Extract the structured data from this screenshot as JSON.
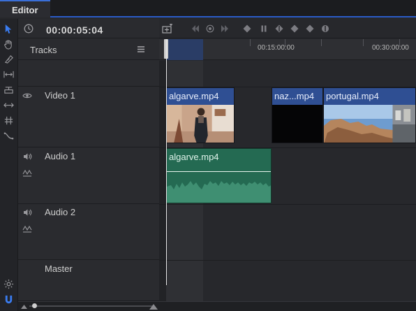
{
  "tab": {
    "label": "Editor"
  },
  "timecode": "00:00:05:04",
  "tracks_header": {
    "label": "Tracks"
  },
  "ruler": {
    "labels": [
      "00:15:00:00",
      "00:30:00:00"
    ]
  },
  "tracks": [
    {
      "name": "Video 1"
    },
    {
      "name": "Audio 1"
    },
    {
      "name": "Audio 2"
    },
    {
      "name": "Master"
    }
  ],
  "video_clips": [
    {
      "title": "algarve.mp4"
    },
    {
      "title": "naz...mp4"
    },
    {
      "title": "portugal.mp4"
    }
  ],
  "audio_clips": [
    {
      "title": "algarve.mp4"
    }
  ],
  "colors": {
    "accent": "#2a5bc7",
    "video_clip": "#2f4f93",
    "audio_clip": "#246a52"
  }
}
